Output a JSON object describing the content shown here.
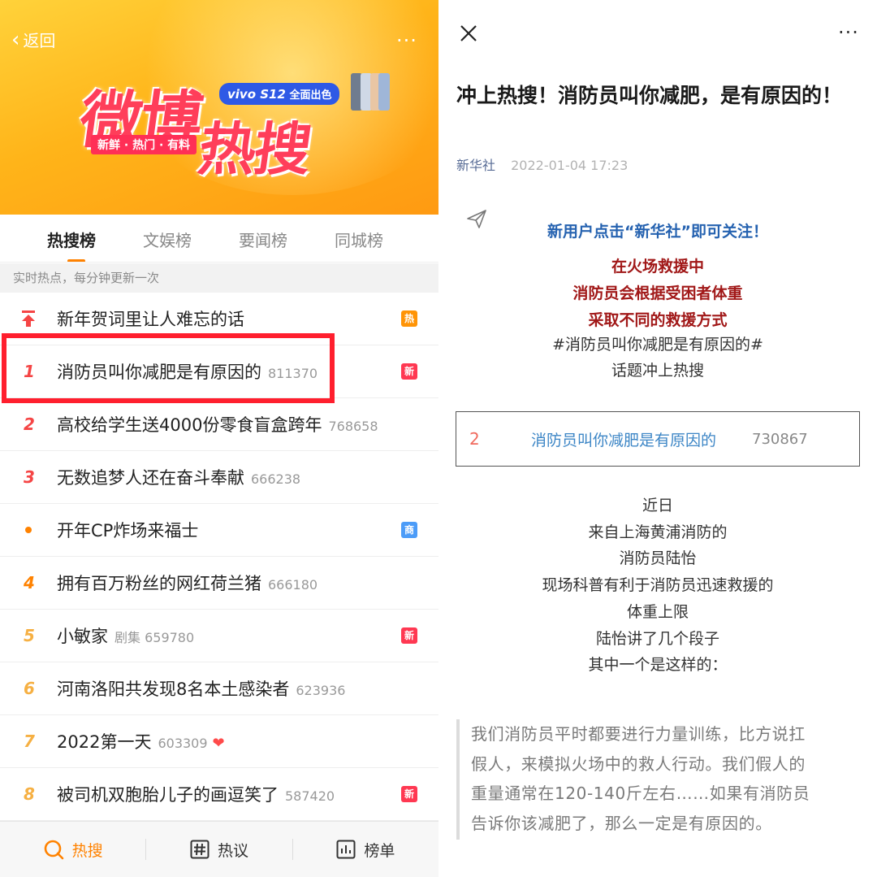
{
  "left": {
    "back_label": "返回",
    "more_label": "···",
    "logo": {
      "char1": "微博",
      "char2": "热搜",
      "tagline": "新鲜 · 热门 · 有料"
    },
    "ad_badge": {
      "brand": "vivo S12",
      "text": "全面出色"
    },
    "tabs": [
      "热搜榜",
      "文娱榜",
      "要闻榜",
      "同城榜"
    ],
    "active_tab": "热搜榜",
    "info_text": "实时热点，每分钟更新一次",
    "rows": [
      {
        "rank": "",
        "marker": "pin",
        "title": "新年贺词里让人难忘的话",
        "meta": "",
        "tag": "热"
      },
      {
        "rank": "1",
        "title": "消防员叫你减肥是有原因的",
        "meta": "811370",
        "tag": "新"
      },
      {
        "rank": "2",
        "title": "高校给学生送4000份零食盲盒跨年",
        "meta": "768658",
        "tag": ""
      },
      {
        "rank": "3",
        "title": "无数追梦人还在奋斗奉献",
        "meta": "666238",
        "tag": ""
      },
      {
        "rank": "",
        "marker": "dot",
        "title": "开年CP炸场来福士",
        "meta": "",
        "tag": "商"
      },
      {
        "rank": "4",
        "title": "拥有百万粉丝的网红荷兰猪",
        "meta": "666180",
        "tag": ""
      },
      {
        "rank": "5",
        "title": "小敏家",
        "meta": "剧集 659780",
        "tag": "新"
      },
      {
        "rank": "6",
        "title": "河南洛阳共发现8名本土感染者",
        "meta": "623936",
        "tag": ""
      },
      {
        "rank": "7",
        "title": "2022第一天",
        "meta": "603309",
        "tag": "",
        "heart": "❤"
      },
      {
        "rank": "8",
        "title": "被司机双胞胎儿子的画逗笑了",
        "meta": "587420",
        "tag": "新"
      }
    ],
    "bottom_nav": [
      {
        "label": "热搜",
        "icon": "search-icon"
      },
      {
        "label": "热议",
        "icon": "hash-icon"
      },
      {
        "label": "榜单",
        "icon": "chart-icon"
      }
    ]
  },
  "right": {
    "more_label": "···",
    "title": "冲上热搜！消防员叫你减肥，是有原因的！",
    "source": "新华社",
    "date": "2022-01-04 17:23",
    "follow_text": "新用户点击“新华社”即可关注！",
    "red_lines": [
      "在火场救援中",
      "消防员会根据受困者体重",
      "采取不同的救援方式"
    ],
    "topic_lines": [
      "#消防员叫你减肥是有原因的#",
      "话题冲上热搜"
    ],
    "hot_card": {
      "rank": "2",
      "title": "消防员叫你减肥是有原因的",
      "count": "730867"
    },
    "body_lines": [
      "近日",
      "来自上海黄浦消防的",
      "消防员陆怡",
      "现场科普有利于消防员迅速救援的",
      "体重上限",
      "陆怡讲了几个段子",
      "其中一个是这样的："
    ],
    "quote_lines": [
      "我们消防员平时都要进行力量训练，比方说扛",
      "假人，来模拟火场中的救人行动。我们假人的",
      "重量通常在120-140斤左右……如果有消防员",
      "告诉你该减肥了，那么一定是有原因的。"
    ]
  }
}
